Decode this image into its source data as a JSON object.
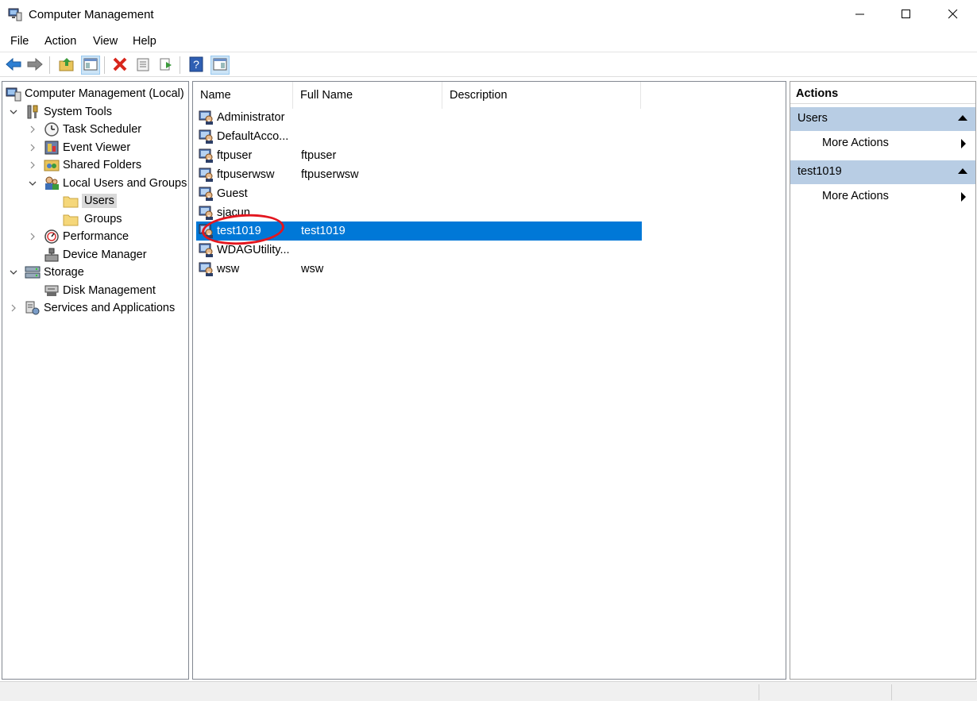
{
  "window": {
    "title": "Computer Management",
    "minimize_icon": "minimize-icon",
    "maximize_icon": "maximize-icon",
    "close_icon": "close-icon"
  },
  "menu": [
    "File",
    "Action",
    "View",
    "Help"
  ],
  "toolbar": {
    "buttons": [
      "back-arrow-icon",
      "forward-arrow-icon",
      "up-folder-icon",
      "show-hide-tree-icon",
      "delete-icon",
      "properties-icon",
      "export-list-icon",
      "help-icon",
      "show-hide-action-pane-icon"
    ]
  },
  "tree": {
    "root": "Computer Management (Local)",
    "system_tools": "System Tools",
    "task_scheduler": "Task Scheduler",
    "event_viewer": "Event Viewer",
    "shared_folders": "Shared Folders",
    "local_users_groups": "Local Users and Groups",
    "users": "Users",
    "groups": "Groups",
    "performance": "Performance",
    "device_manager": "Device Manager",
    "storage": "Storage",
    "disk_management": "Disk Management",
    "services_apps": "Services and Applications"
  },
  "list": {
    "columns": [
      "Name",
      "Full Name",
      "Description"
    ],
    "rows": [
      {
        "name": "Administrator",
        "full_name": ""
      },
      {
        "name": "DefaultAcco...",
        "full_name": ""
      },
      {
        "name": "ftpuser",
        "full_name": "ftpuser"
      },
      {
        "name": "ftpuserwsw",
        "full_name": "ftpuserwsw"
      },
      {
        "name": "Guest",
        "full_name": ""
      },
      {
        "name": "sjacun",
        "full_name": ""
      },
      {
        "name": "test1019",
        "full_name": "test1019"
      },
      {
        "name": "WDAGUtility...",
        "full_name": ""
      },
      {
        "name": "wsw",
        "full_name": "wsw"
      }
    ],
    "selected_index": 6
  },
  "actions": {
    "header": "Actions",
    "group1": "Users",
    "group1_item": "More Actions",
    "group2": "test1019",
    "group2_item": "More Actions"
  },
  "colors": {
    "selection": "#0078d7",
    "action_group_bg": "#b8cde4",
    "highlight_ellipse": "#e3161f"
  }
}
